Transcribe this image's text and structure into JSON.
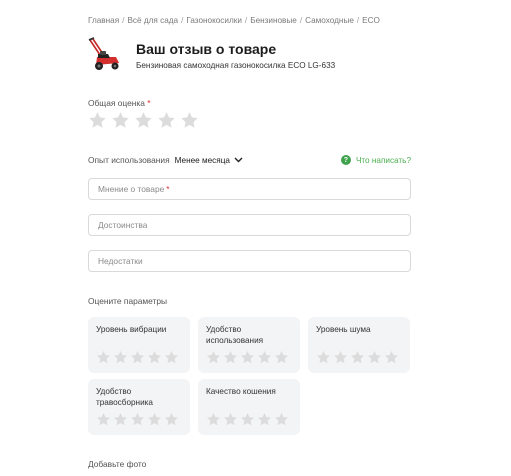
{
  "breadcrumb": [
    {
      "label": "Главная"
    },
    {
      "label": "Всё для сада"
    },
    {
      "label": "Газонокосилки"
    },
    {
      "label": "Бензиновые"
    },
    {
      "label": "Самоходные"
    },
    {
      "label": "ECO"
    }
  ],
  "breadcrumb_separator": "/",
  "header": {
    "title": "Ваш отзыв о товаре",
    "product_name": "Бензиновая самоходная газонокосилка ECO LG-633"
  },
  "overall_rating": {
    "label": "Общая оценка",
    "required_mark": "*",
    "stars_total": 5,
    "stars_selected": 0
  },
  "experience": {
    "label": "Опыт использования",
    "selected": "Менее месяца"
  },
  "help_link": {
    "icon": "question-circle-icon",
    "text": "Что написать?"
  },
  "fields": {
    "opinion": {
      "placeholder": "Мнение о товаре",
      "required_mark": "*"
    },
    "pros": {
      "placeholder": "Достоинства"
    },
    "cons": {
      "placeholder": "Недостатки"
    }
  },
  "params": {
    "label": "Оцените параметры",
    "items": [
      {
        "name": "Уровень вибрации",
        "stars_total": 5,
        "stars_selected": 0
      },
      {
        "name": "Удобство использования",
        "stars_total": 5,
        "stars_selected": 0
      },
      {
        "name": "Уровень шума",
        "stars_total": 5,
        "stars_selected": 0
      },
      {
        "name": "Удобство травосборника",
        "stars_total": 5,
        "stars_selected": 0
      },
      {
        "name": "Качество кошения",
        "stars_total": 5,
        "stars_selected": 0
      }
    ]
  },
  "add_photo": {
    "label": "Добавьте фото"
  },
  "colors": {
    "star_empty": "#dcdcdc",
    "required": "#e02a2a",
    "help_green": "#3fa34d",
    "card_bg": "#f3f4f6"
  }
}
